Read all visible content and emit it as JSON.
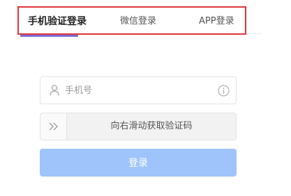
{
  "tabs": {
    "phone_login": "手机验证登录",
    "wechat_login": "微信登录",
    "app_login": "APP登录",
    "active": "phone_login"
  },
  "colors": {
    "highlight_border": "#e0353a",
    "active_tab_underline": "#7b6ad3",
    "login_button": "#9fc4fb"
  },
  "phone_field": {
    "placeholder": "手机号",
    "value": "",
    "leading_icon": "user-icon",
    "trailing_icon": "info-icon"
  },
  "slider": {
    "handle_icon": "double-chevron-right-icon",
    "text": "向右滑动获取验证码"
  },
  "login_button": {
    "label": "登录"
  }
}
